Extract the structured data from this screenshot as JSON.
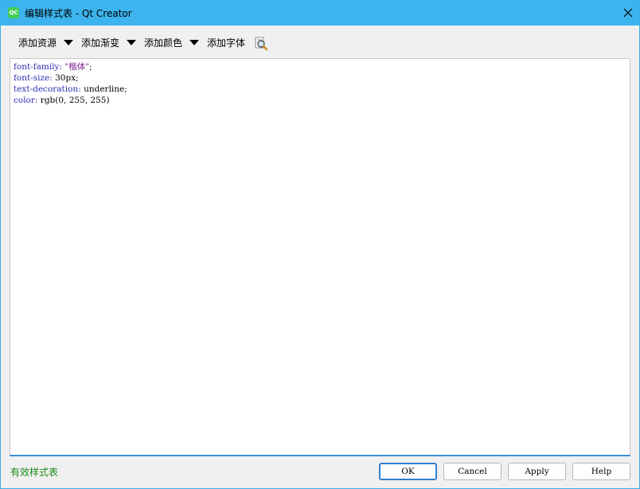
{
  "window": {
    "title": "编辑样式表 - Qt Creator",
    "app_icon_text": "QC"
  },
  "toolbar": {
    "add_resource": "添加资源",
    "add_gradient": "添加渐变",
    "add_color": "添加颜色",
    "add_font": "添加字体"
  },
  "editor": {
    "lines": [
      {
        "prop": "font-family",
        "sep": ": ",
        "value": "\"楷体\"",
        "end": ";"
      },
      {
        "prop": "font-size",
        "sep": ": ",
        "value": "30px",
        "end": ";"
      },
      {
        "prop": "text-decoration",
        "sep": ": ",
        "value": "underline",
        "end": ";"
      },
      {
        "prop": "color",
        "sep": ": ",
        "value": "rgb(0, 255, 255)",
        "end": ""
      }
    ]
  },
  "status": {
    "text": "有效样式表",
    "color": "#1a8a1a"
  },
  "buttons": {
    "ok": "OK",
    "cancel": "Cancel",
    "apply": "Apply",
    "help": "Help"
  },
  "colors": {
    "titlebar": "#3db4ee",
    "accent": "#2f7fd0"
  }
}
